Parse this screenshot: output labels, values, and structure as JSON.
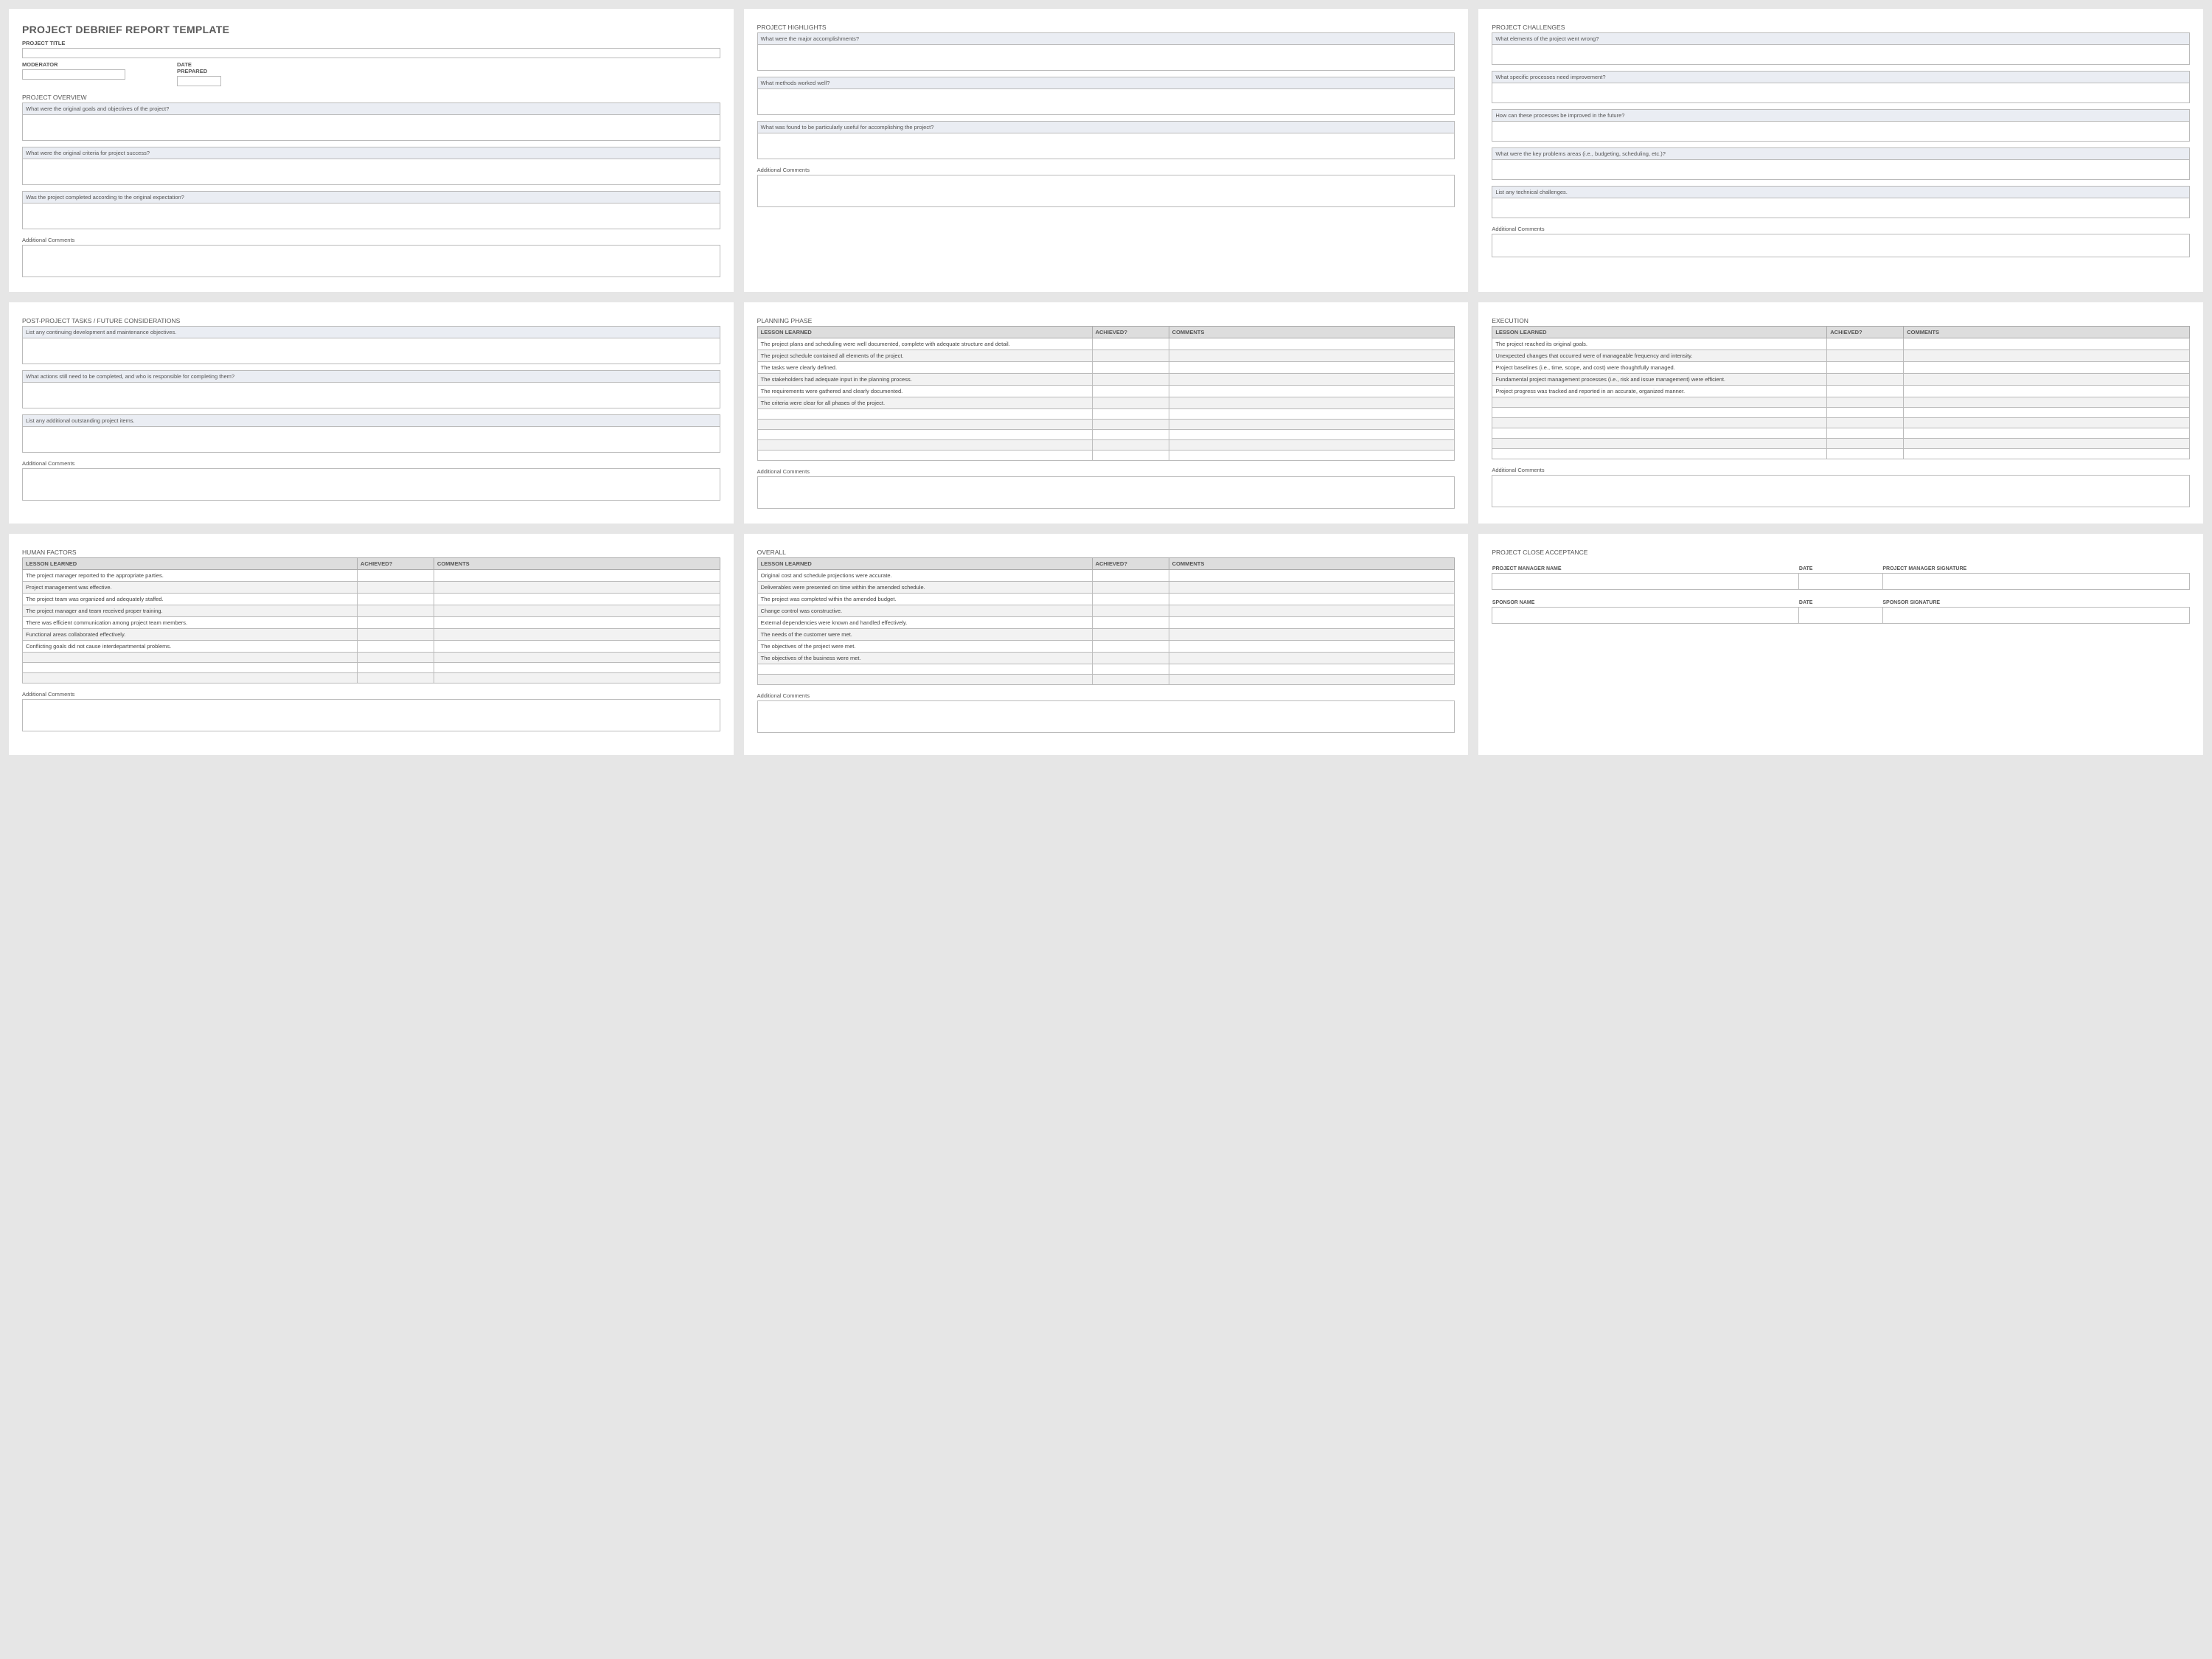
{
  "doc": {
    "title": "PROJECT DEBRIEF REPORT TEMPLATE",
    "project_title_label": "PROJECT TITLE",
    "moderator_label": "MODERATOR",
    "date_prepared_label": "DATE PREPARED"
  },
  "overview": {
    "heading": "PROJECT OVERVIEW",
    "q1": "What were the original goals and objectives of the project?",
    "q2": "What were the original criteria for project success?",
    "q3": "Was the project completed according to the original expectation?",
    "ac": "Additional Comments"
  },
  "highlights": {
    "heading": "PROJECT HIGHLIGHTS",
    "q1": "What were the major accomplishments?",
    "q2": "What methods worked well?",
    "q3": "What was found to be particularly useful for accomplishing the project?",
    "ac": "Additional Comments"
  },
  "challenges": {
    "heading": "PROJECT CHALLENGES",
    "q1": "What elements of the project went wrong?",
    "q2": "What specific processes need improvement?",
    "q3": "How can these processes be improved in the future?",
    "q4": "What were the key problems areas (i.e., budgeting, scheduling, etc.)?",
    "q5": "List any technical challenges.",
    "ac": "Additional Comments"
  },
  "postproject": {
    "heading": "POST-PROJECT TASKS / FUTURE CONSIDERATIONS",
    "q1": "List any continuing development and maintenance objectives.",
    "q2": "What actions still need to be completed, and who is responsible for completing them?",
    "q3": "List any additional outstanding project items.",
    "ac": "Additional Comments"
  },
  "columns": {
    "lesson": "LESSON LEARNED",
    "achieved": "ACHIEVED?",
    "comments": "COMMENTS"
  },
  "planning": {
    "heading": "PLANNING PHASE",
    "rows": [
      "The project plans and scheduling were well documented, complete with adequate structure and detail.",
      "The project schedule contained all elements of the project.",
      "The tasks were clearly defined.",
      "The stakeholders had adequate input in the planning process.",
      "The requirements were gathered and clearly documented.",
      "The criteria were clear for all phases of the project.",
      "",
      "",
      "",
      "",
      ""
    ],
    "ac": "Additional Comments"
  },
  "execution": {
    "heading": "EXECUTION",
    "rows": [
      "The project reached its original goals.",
      "Unexpected changes that occurred were of manageable frequency and intensity.",
      "Project baselines (i.e., time, scope, and cost) were thoughtfully managed.",
      "Fundamental project management processes (i.e., risk and issue management) were efficient.",
      "Project progress was tracked and reported in an accurate, organized manner.",
      "",
      "",
      "",
      "",
      "",
      ""
    ],
    "ac": "Additional Comments"
  },
  "human": {
    "heading": "HUMAN FACTORS",
    "rows": [
      "The project manager reported to the appropriate parties.",
      "Project management was effective.",
      "The project team was organized and adequately staffed.",
      "The project manager and team received proper training.",
      "There was efficient communication among project team members.",
      "Functional areas collaborated effectively.",
      "Conflicting goals did not cause interdepartmental problems.",
      "",
      "",
      ""
    ],
    "ac": "Additional Comments"
  },
  "overall": {
    "heading": "OVERALL",
    "rows": [
      "Original cost and schedule projections were accurate.",
      "Deliverables were presented on time within the amended schedule.",
      "The project was completed within the amended budget.",
      "Change control was constructive.",
      "External dependencies were known and handled effectively.",
      "The needs of the customer were met.",
      "The objectives of the project were met.",
      "The objectives of the business were met.",
      "",
      ""
    ],
    "ac": "Additional Comments"
  },
  "close": {
    "heading": "PROJECT CLOSE ACCEPTANCE",
    "pm_name": "PROJECT MANAGER NAME",
    "date": "DATE",
    "pm_sig": "PROJECT MANAGER SIGNATURE",
    "sp_name": "SPONSOR NAME",
    "sp_sig": "SPONSOR SIGNATURE"
  }
}
